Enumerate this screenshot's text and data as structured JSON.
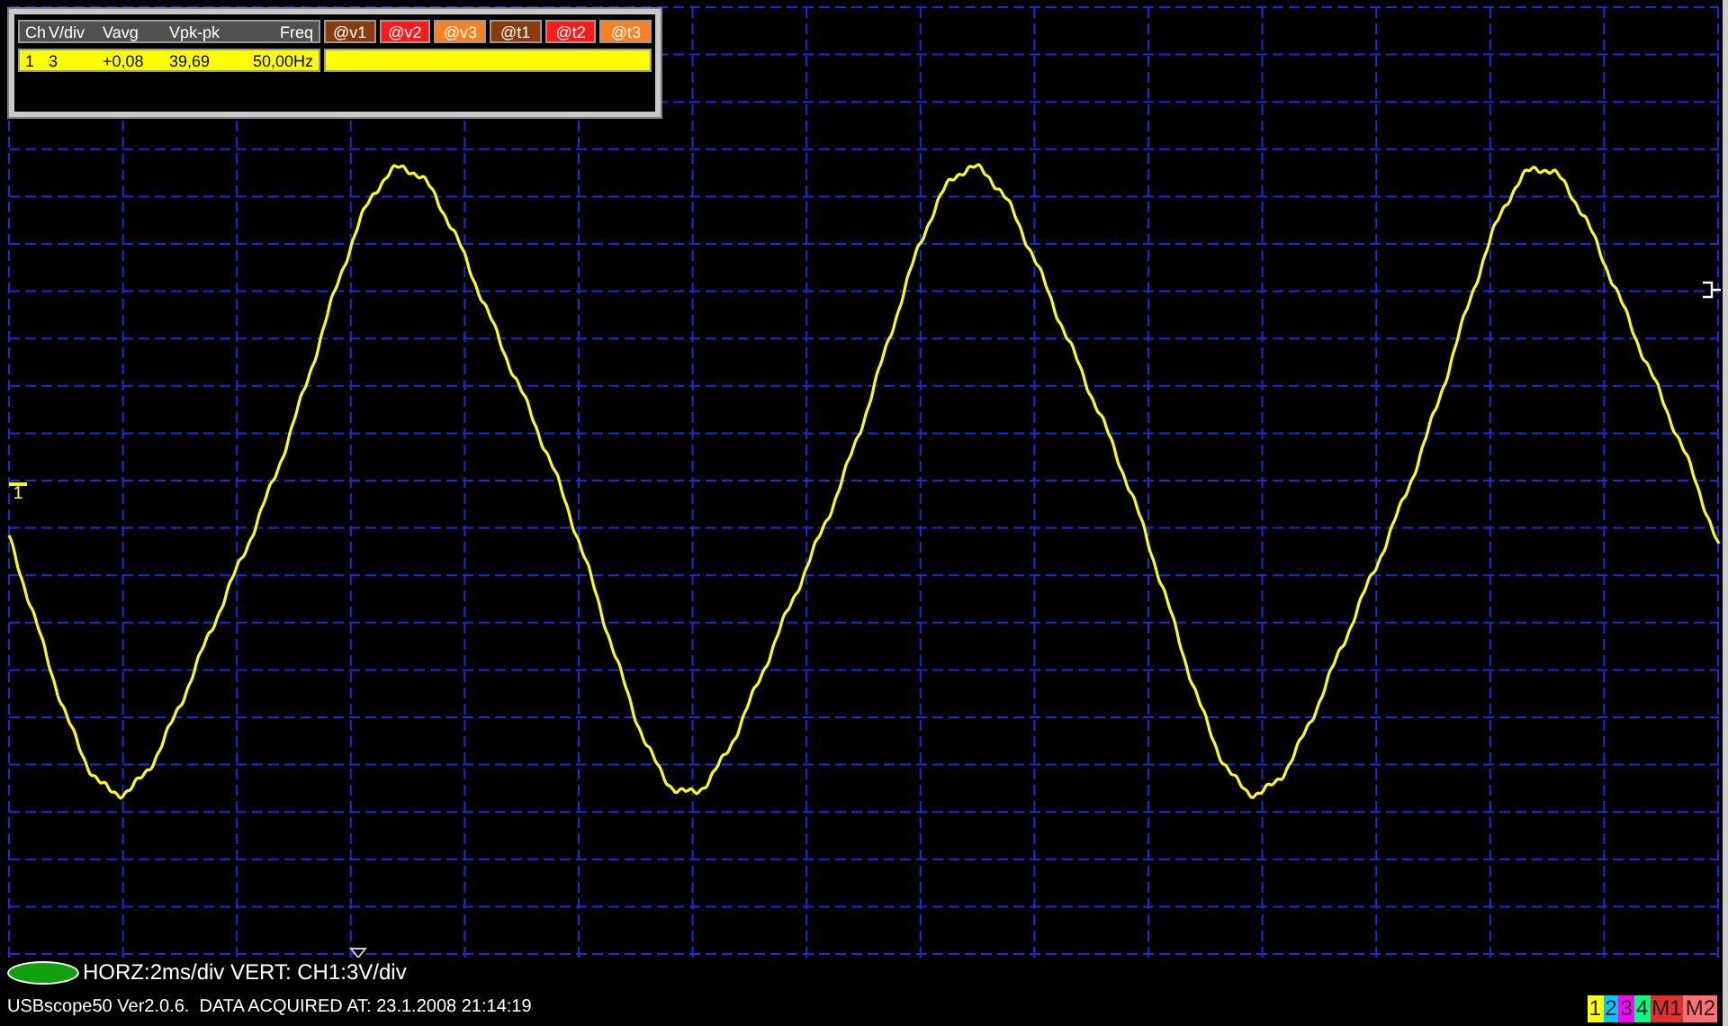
{
  "measurements": {
    "columns": [
      "Ch",
      "V/div",
      "Vavg",
      "Vpk-pk",
      "Freq"
    ],
    "rows": [
      {
        "cells": [
          "1",
          "3",
          "+0,08",
          "39,69",
          "50,00Hz"
        ]
      }
    ],
    "cursors": [
      {
        "label": "@v1",
        "color": "#8b3a0a"
      },
      {
        "label": "@v2",
        "color": "#ff1a1a"
      },
      {
        "label": "@v3",
        "color": "#ff8020"
      },
      {
        "label": "@t1",
        "color": "#8b3a0a"
      },
      {
        "label": "@t2",
        "color": "#ff1a1a"
      },
      {
        "label": "@t3",
        "color": "#ff8020"
      }
    ]
  },
  "ground_marker": {
    "label": "1"
  },
  "settings": "HORZ:2ms/div VERT: CH1:3V/div",
  "status": "USBscope50 Ver2.0.6.  DATA ACQUIRED AT: 23.1.2008 21:14:19",
  "channels": [
    {
      "label": "1",
      "color": "#ffff00"
    },
    {
      "label": "2",
      "color": "#00c8ff"
    },
    {
      "label": "3",
      "color": "#ff00ff"
    },
    {
      "label": "4",
      "color": "#00ff80"
    },
    {
      "label": "M1",
      "color": "#e03030"
    },
    {
      "label": "M2",
      "color": "#ff7070"
    }
  ]
}
